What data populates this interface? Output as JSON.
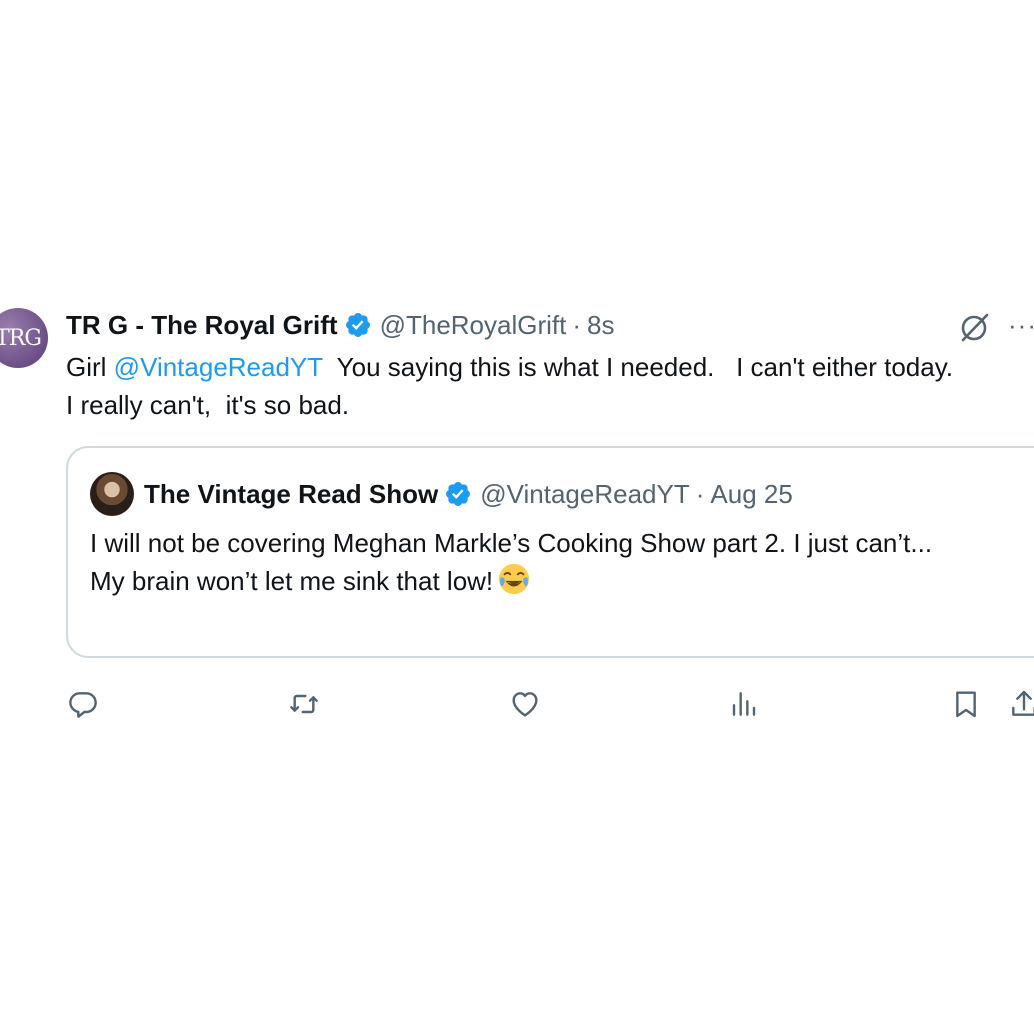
{
  "tweet": {
    "avatar_text": "TRG",
    "display_name": "TR G - The Royal Grift",
    "handle": "@TheRoyalGrift",
    "separator": "·",
    "time": "8s",
    "more_label": "···",
    "text_prefix": "Girl ",
    "mention": "@VintageReadYT",
    "text_suffix": "  You saying this is what I needed.   I can't either today.\nI really can't,  it's so bad."
  },
  "quote": {
    "display_name": "The Vintage Read Show",
    "handle": "@VintageReadYT",
    "separator": "·",
    "date": "Aug 25",
    "text": "I will not be covering Meghan Markle’s Cooking Show part 2. I just can’t...\nMy brain won’t let me sink that low!",
    "emoji": "face-with-tears-of-joy"
  },
  "actions": [
    "reply-icon",
    "retweet-icon",
    "like-icon",
    "views-icon",
    "bookmark-icon",
    "share-icon"
  ],
  "colors": {
    "text": "#0f1419",
    "secondary": "#536471",
    "link": "#1d9bf0",
    "border": "#cfd9de",
    "verified": "#1d9bf0"
  }
}
